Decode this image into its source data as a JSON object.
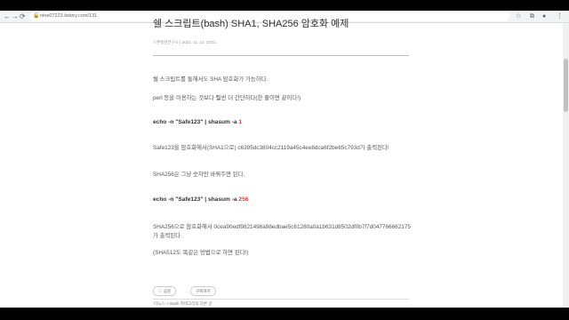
{
  "browser": {
    "url": "nine07223.tistory.com/131",
    "nav": {
      "back": "←",
      "forward": "→",
      "reload": "⟳"
    }
  },
  "post": {
    "title": "쉘 스크립트(bash) SHA1, SHA256 암호화 예제",
    "meta": "스푼빌련연구소  |  2021. 11. 12. 23:51",
    "intro": "쉘 스크립트를 통해서도 SHA 암호화가 가능하다.",
    "perl_note": "perl 등을 이용하는 것보다 훨씬 더 간단하다(한 줄이면 끝이다!)",
    "cmd1_prefix": "echo -n \"Safe123\" | shasum -a ",
    "cmd1_arg": "1",
    "sha1_result": "Safe123을 암호화해서(SHA1으로) c6395dc3804cc2119a45c4ee8dca6f2be65c793d가 출력된다!",
    "sha256_note": "SHA256은 그냥 숫자만 바꿔주면 된다.",
    "cmd2_prefix": "echo -n \"Safe123\" | shasum -a ",
    "cmd2_arg": "256",
    "sha256_result_line1": "SHA256으로 암호화해서 0cea90edf9821498a98edbae5c61280a0a1b631d8502df0b7f7d047766662175",
    "sha256_result_line2": "가 출력된다.",
    "sha512_note": "(SHA512도 똑같은 방법으로 하면 된다!)"
  },
  "actions": {
    "like_label": "공감",
    "subscribe_label": "구독하기"
  },
  "footer": {
    "text": "'리눅스' > Bash 카테고리의 다른 글"
  },
  "colors": {
    "accent_red": "#e03a2f"
  },
  "icons": [
    "back-icon",
    "forward-icon",
    "reload-icon",
    "lock-icon",
    "star-icon",
    "extension-icon",
    "profile-icon",
    "menu-icon",
    "heart-icon"
  ]
}
